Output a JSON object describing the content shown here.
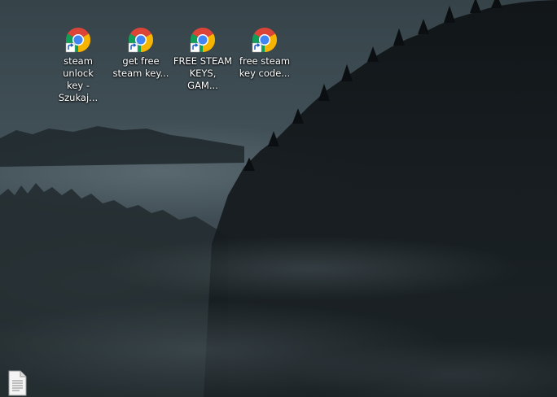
{
  "desktop": {
    "shortcuts": [
      {
        "label": "steam unlock\nkey - Szukaj...",
        "icon": "chrome-shortcut-icon"
      },
      {
        "label": "get free\nsteam key...",
        "icon": "chrome-shortcut-icon"
      },
      {
        "label": "FREE STEAM\nKEYS, GAM...",
        "icon": "chrome-shortcut-icon"
      },
      {
        "label": "free steam\nkey code...",
        "icon": "chrome-shortcut-icon"
      }
    ],
    "file_icon": "text-document-icon"
  },
  "colors": {
    "chrome_red": "#db4437",
    "chrome_yellow": "#f4b400",
    "chrome_green": "#0f9d58",
    "chrome_blue": "#4285f4",
    "sky": "#3d4a50",
    "forest": "#0e1214"
  }
}
